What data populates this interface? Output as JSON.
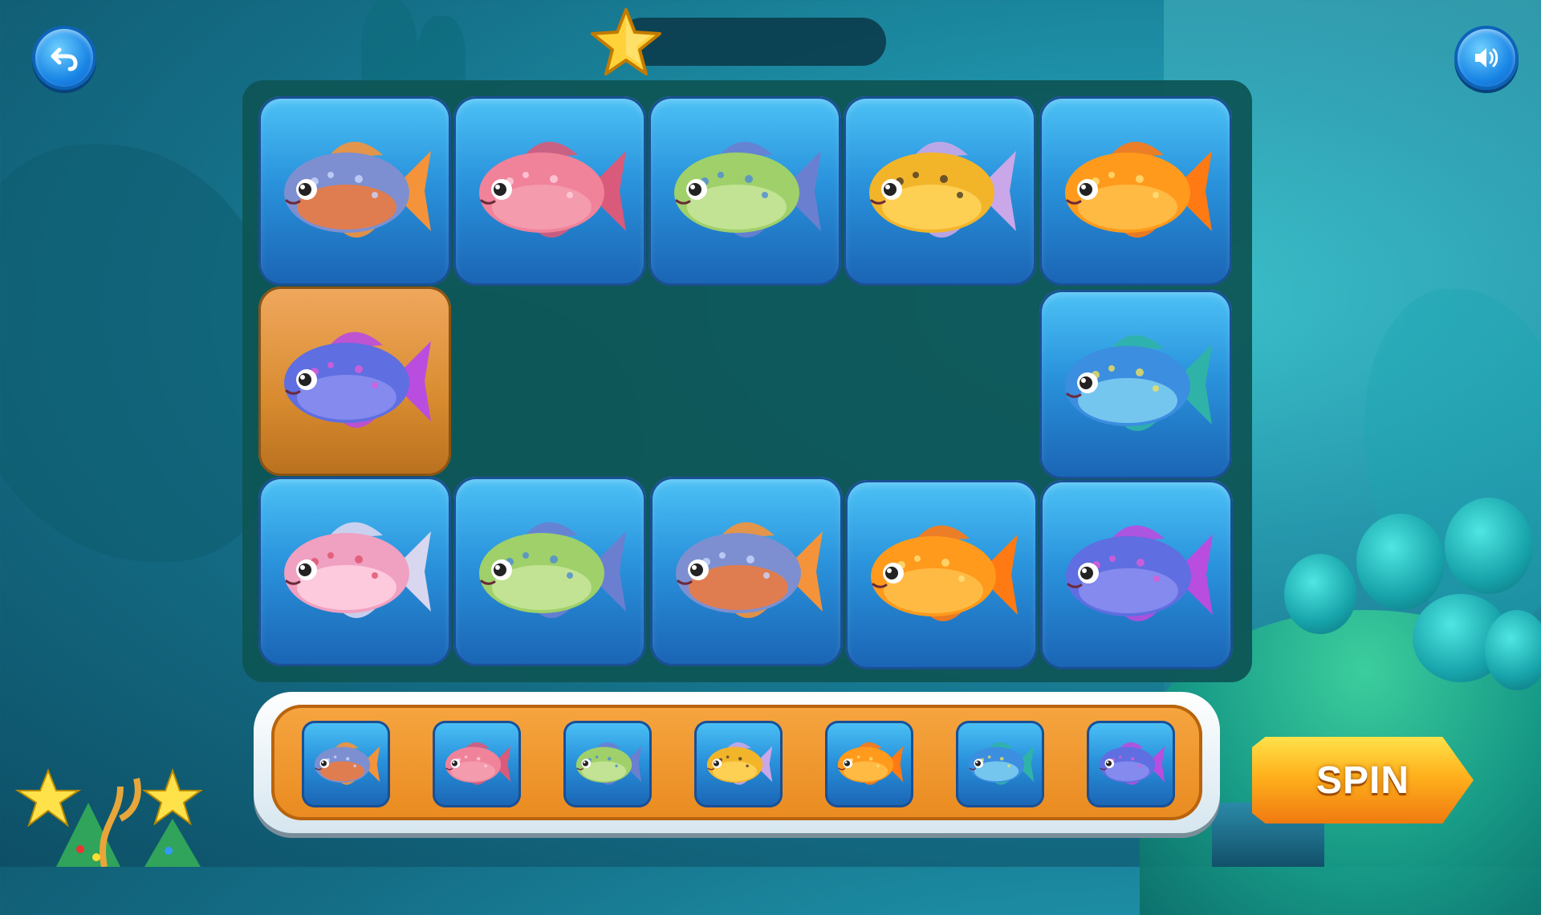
{
  "controls": {
    "back": {
      "icon": "back-arrow-icon"
    },
    "sound": {
      "icon": "speaker-icon"
    },
    "spin_label": "SPIN"
  },
  "score": {
    "icon": "star-icon",
    "value": ""
  },
  "board": {
    "selected_index": 5,
    "tiles": [
      {
        "fish": "red-blue-fish"
      },
      {
        "fish": "flowerhorn-fish"
      },
      {
        "fish": "discus-fish"
      },
      {
        "fish": "striped-yellow-fish"
      },
      {
        "fish": "goldfish"
      },
      {
        "fish": "betta-fish"
      },
      {
        "fish": "spotted-cichlid-fish"
      },
      {
        "fish": "guppy-fish"
      },
      {
        "fish": "discus-fish"
      },
      {
        "fish": "red-blue-fish"
      },
      {
        "fish": "goldfish"
      },
      {
        "fish": "betta-fish"
      }
    ]
  },
  "paytable": [
    {
      "fish": "red-blue-fish"
    },
    {
      "fish": "flowerhorn-fish"
    },
    {
      "fish": "discus-fish"
    },
    {
      "fish": "striped-yellow-fish"
    },
    {
      "fish": "goldfish"
    },
    {
      "fish": "spotted-cichlid-fish"
    },
    {
      "fish": "betta-fish"
    }
  ],
  "colors": {
    "tile_blue": "#2a93dc",
    "tile_active": "#d88b2f",
    "board_bg": "#0e5556",
    "panel_orange": "#e98b20",
    "spin_yellow": "#ffb11c"
  }
}
